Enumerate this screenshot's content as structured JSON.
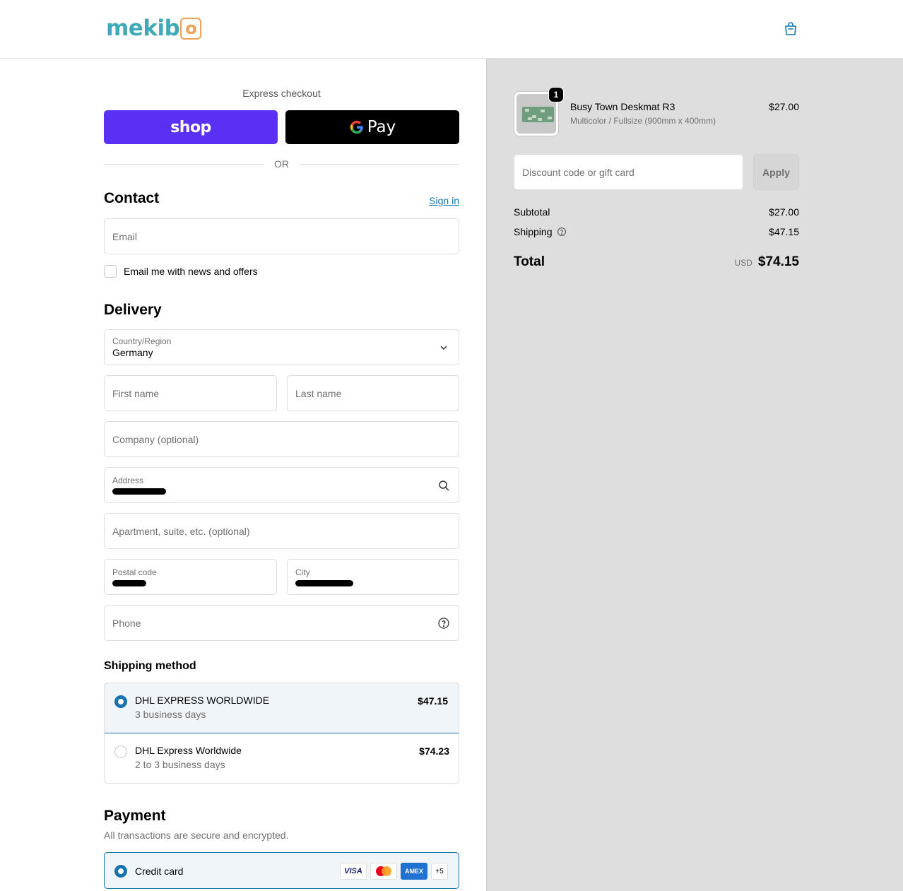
{
  "header": {
    "logo_part1": "mekib",
    "logo_part2": "o",
    "cart_icon": "shopping-bag-icon"
  },
  "express": {
    "label": "Express checkout",
    "shop_label": "shop",
    "gpay_label": "Pay",
    "or_label": "OR"
  },
  "contact": {
    "title": "Contact",
    "sign_in": "Sign in",
    "email_placeholder": "Email",
    "newsletter_label": "Email me with news and offers"
  },
  "delivery": {
    "title": "Delivery",
    "country_label": "Country/Region",
    "country_value": "Germany",
    "first_name_placeholder": "First name",
    "last_name_placeholder": "Last name",
    "company_placeholder": "Company (optional)",
    "address_label": "Address",
    "apartment_placeholder": "Apartment, suite, etc. (optional)",
    "postal_label": "Postal code",
    "city_label": "City",
    "phone_placeholder": "Phone"
  },
  "shipping": {
    "title": "Shipping method",
    "options": [
      {
        "name": "DHL EXPRESS WORLDWIDE",
        "sub": "3 business days",
        "price": "$47.15",
        "selected": true
      },
      {
        "name": "DHL Express Worldwide",
        "sub": "2 to 3 business days",
        "price": "$74.23",
        "selected": false
      }
    ]
  },
  "payment": {
    "title": "Payment",
    "subtitle": "All transactions are secure and encrypted.",
    "method": "Credit card",
    "cards": [
      "VISA",
      "AMEX",
      "+5"
    ]
  },
  "summary": {
    "quantity": "1",
    "product_name": "Busy Town Deskmat R3",
    "product_variant": "Multicolor / Fullsize (900mm x 400mm)",
    "product_price": "$27.00",
    "discount_placeholder": "Discount code or gift card",
    "apply_label": "Apply",
    "subtotal_label": "Subtotal",
    "subtotal_value": "$27.00",
    "shipping_label": "Shipping",
    "shipping_value": "$47.15",
    "total_label": "Total",
    "currency": "USD",
    "total_value": "$74.15"
  },
  "colors": {
    "accent": "#1773b0",
    "shop": "#5a31f4",
    "panel": "#dedede",
    "logo_teal": "#3fa9b8",
    "logo_orange": "#f0a057"
  }
}
